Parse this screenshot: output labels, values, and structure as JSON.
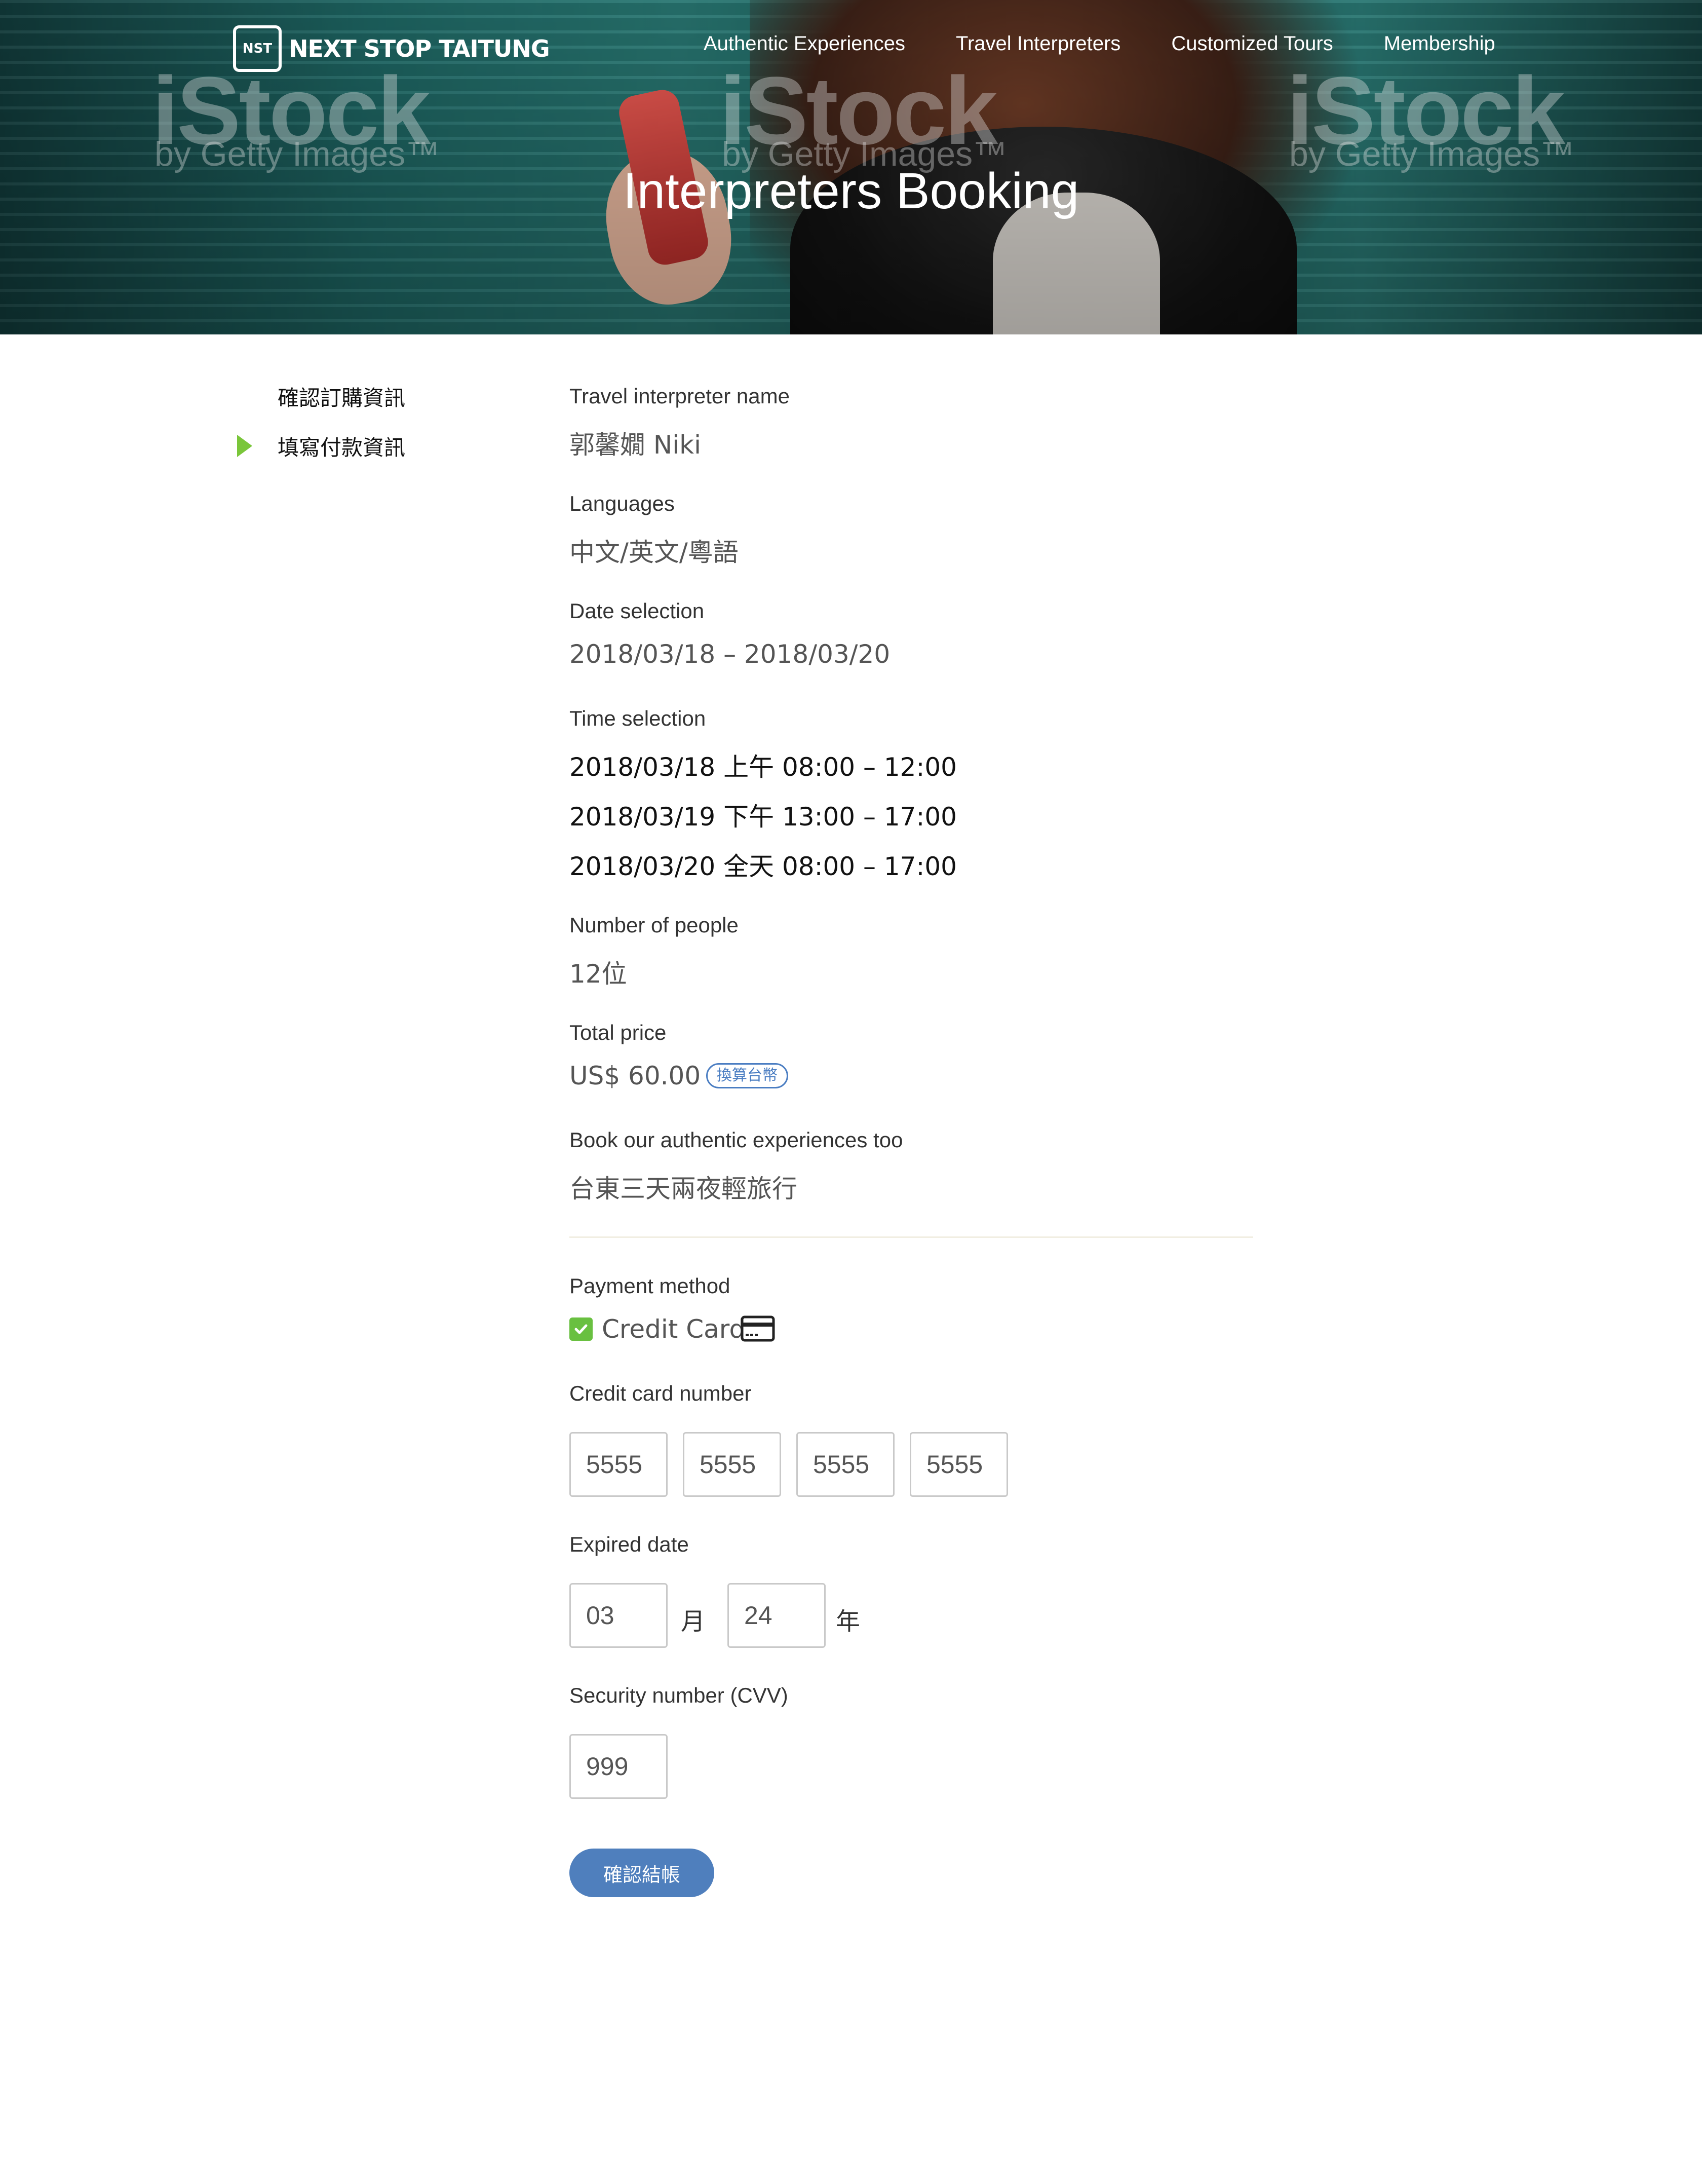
{
  "brand": {
    "logo_mark": "NST",
    "name": "NEXT STOP TAITUNG"
  },
  "nav": {
    "items": [
      "Authentic Experiences",
      "Travel Interpreters",
      "Customized Tours",
      "Membership"
    ]
  },
  "hero": {
    "title": "Interpreters Booking",
    "watermark": [
      "iStock",
      "by Getty Images™"
    ]
  },
  "steps": [
    {
      "label": "確認訂購資訊",
      "active": false
    },
    {
      "label": "填寫付款資訊",
      "active": true
    }
  ],
  "booking": {
    "interpreter_label": "Travel interpreter name",
    "interpreter_value": "郭馨嫺 Niki",
    "languages_label": "Languages",
    "languages_value": "中文/英文/粵語",
    "date_label": "Date selection",
    "date_value": "2018/03/18 – 2018/03/20",
    "time_label": "Time selection",
    "time_slots": [
      "2018/03/18 上午 08:00 – 12:00",
      "2018/03/19 下午 13:00 – 17:00",
      "2018/03/20 全天 08:00 – 17:00"
    ],
    "people_label": "Number of people",
    "people_value": "12位",
    "price_label": "Total price",
    "price_value": "US$ 60.00",
    "convert_badge": "換算台幣",
    "experience_label": "Book our authentic experiences too",
    "experience_value": "台東三天兩夜輕旅行"
  },
  "payment": {
    "method_label": "Payment method",
    "method_value": "Credit Card",
    "method_checked": true,
    "method_icon": "credit-card-icon",
    "card_label": "Credit card number",
    "card_numbers": [
      "5555",
      "5555",
      "5555",
      "5555"
    ],
    "expiry_label": "Expired date",
    "expiry_month": "03",
    "expiry_month_unit": "月",
    "expiry_year": "24",
    "expiry_year_unit": "年",
    "cvv_label": "Security number (CVV)",
    "cvv_value": "999",
    "submit_label": "確認結帳"
  },
  "colors": {
    "accent_green": "#7ac63a",
    "button_blue": "#4f7fbd",
    "badge_blue": "#4a7dc2"
  }
}
